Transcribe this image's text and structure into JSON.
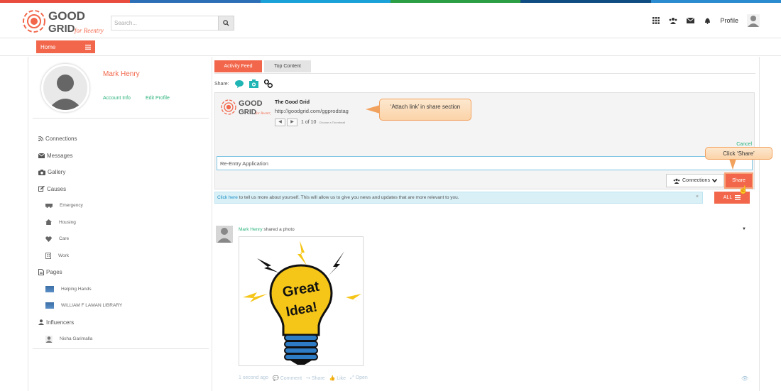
{
  "colors": {
    "accent": "#f2674b",
    "link": "#2ab27b",
    "info_bg": "#d9f0f7",
    "callout": "#fbd3a8"
  },
  "topstripe": [
    "#e94c3d",
    "#2c6fb6",
    "#1aa1d8",
    "#2c9f45",
    "#0f4c81",
    "#2a8bd0"
  ],
  "brand": {
    "logo_name": "THE GOOD GRID",
    "logo_tagline": "for Reentry"
  },
  "header": {
    "search_placeholder": "Search...",
    "icons": [
      "grid-icon",
      "users-icon",
      "envelope-icon",
      "bell-icon"
    ],
    "profile_label": "Profile"
  },
  "subbar": {
    "home_label": "Home"
  },
  "profile": {
    "name": "Mark Henry",
    "account_info": "Account Info",
    "edit_profile": "Edit Profile"
  },
  "sidebar": {
    "connections": "Connections",
    "messages": "Messages",
    "gallery": "Gallery",
    "causes": "Causes",
    "causes_items": [
      {
        "label": "Emergency",
        "icon": "ambulance-icon"
      },
      {
        "label": "Housing",
        "icon": "home-icon"
      },
      {
        "label": "Care",
        "icon": "heart-icon"
      },
      {
        "label": "Work",
        "icon": "building-icon"
      }
    ],
    "pages": "Pages",
    "pages_items": [
      "Helping Hands",
      "WILLIAM F LAMAN LIBRARY"
    ],
    "influencers": "Influencers",
    "influencers_items": [
      "Nisha Garimalla"
    ]
  },
  "tabs": {
    "activity": "Activity Feed",
    "top": "Top Content"
  },
  "share": {
    "label": "Share:",
    "preview_title": "The Good Grid",
    "preview_url": "http://goodgrid.com/ggprodstag",
    "preview_count": "1 of 10",
    "preview_choose": "Choose a Thumbnail",
    "cancel": "Cancel",
    "input_value": "Re-Entry Application",
    "connections_label": "Connections",
    "share_button": "Share"
  },
  "info": {
    "link": "Click here",
    "text": " to tell us more about yourself. This will allow us to give you news and updates that are more relevant to you.",
    "close": "×",
    "all_label": "ALL"
  },
  "post": {
    "author": "Mark Henry",
    "action": " shared a photo",
    "image_text1": "Great",
    "image_text2": "Idea!",
    "time": "1 second ago",
    "comment": "Comment",
    "share": "Share",
    "like": "Like",
    "open": "Open"
  },
  "callouts": {
    "attach": "‘Attach link’ in share section",
    "click_share": "Click ‘Share’"
  }
}
